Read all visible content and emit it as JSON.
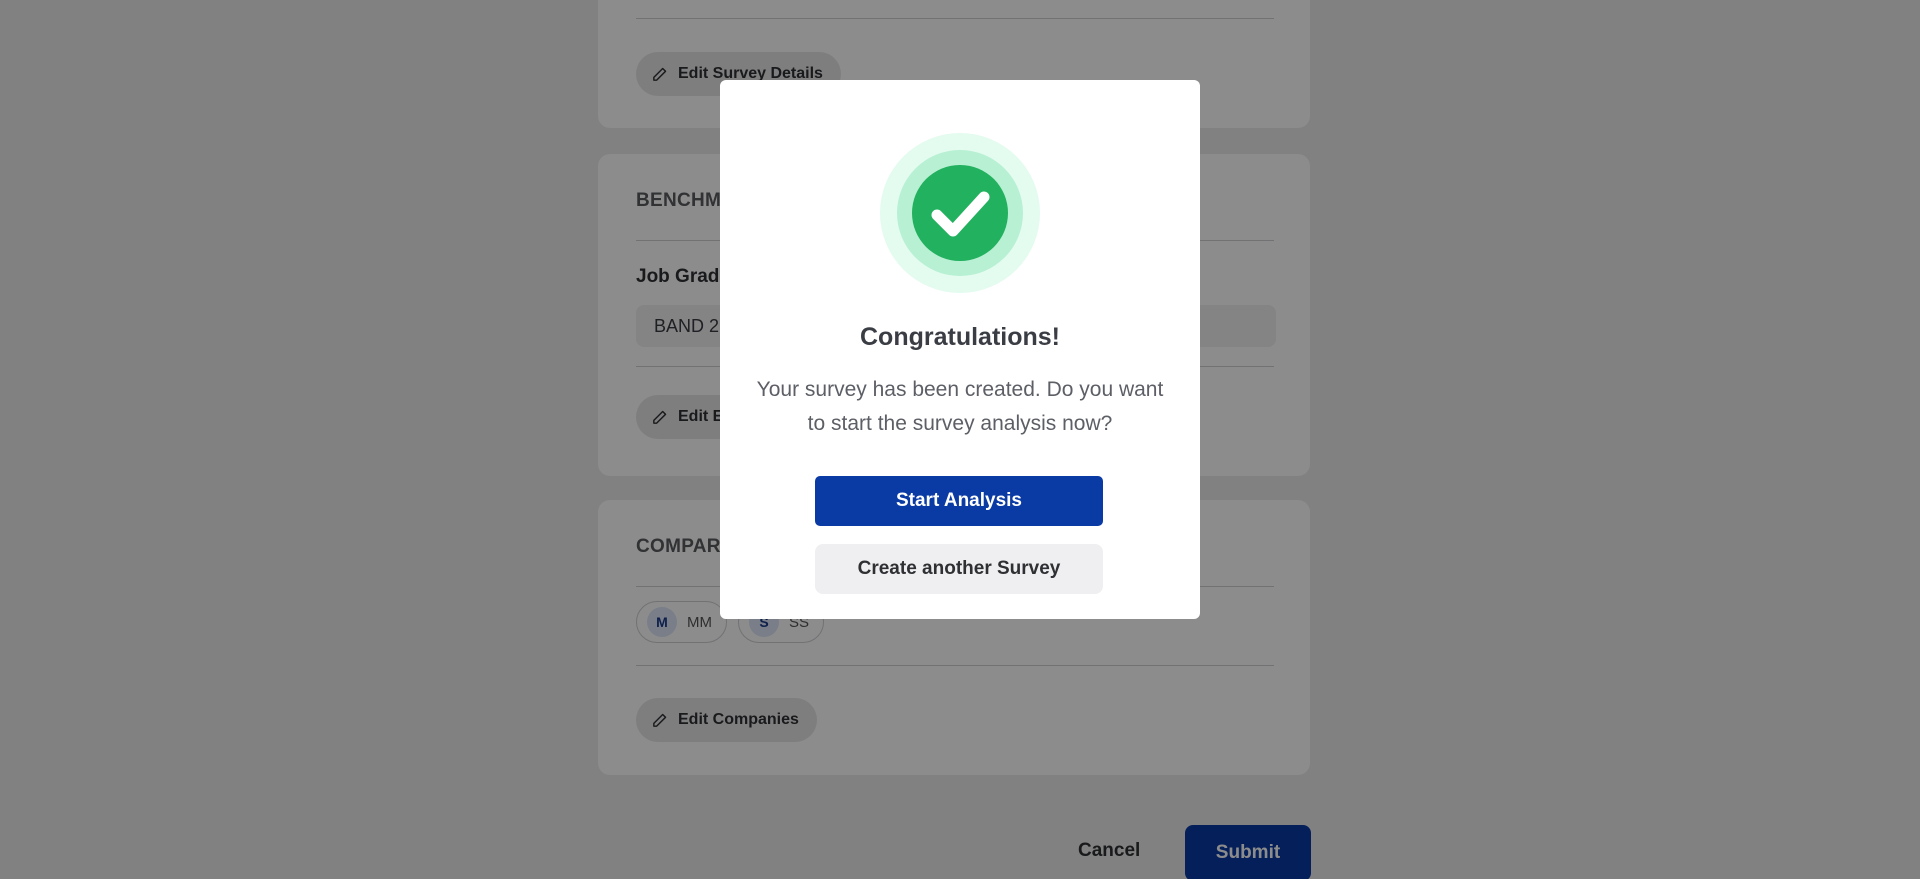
{
  "background": {
    "survey_details": {
      "edit_label": "Edit Survey Details"
    },
    "benchmark": {
      "section_title": "BENCHMA",
      "field_label": "Job Grade",
      "field_value": "BAND 2",
      "edit_label": "Edit E"
    },
    "companies": {
      "section_title": "COMPARE",
      "chips": [
        {
          "initial": "M",
          "name": "MM"
        },
        {
          "initial": "S",
          "name": "SS"
        }
      ],
      "edit_label": "Edit Companies"
    },
    "footer": {
      "cancel_label": "Cancel",
      "submit_label": "Submit"
    }
  },
  "modal": {
    "icon": "check-circle-icon",
    "title": "Congratulations!",
    "message": "Your survey has been created. Do you want to start the survey analysis now?",
    "primary_label": "Start Analysis",
    "secondary_label": "Create another Survey"
  },
  "colors": {
    "primary": "#0a3aa4",
    "success": "#22b15e",
    "success_ring_inner": "#b8f0d4",
    "success_ring_outer": "#e4fbef"
  }
}
